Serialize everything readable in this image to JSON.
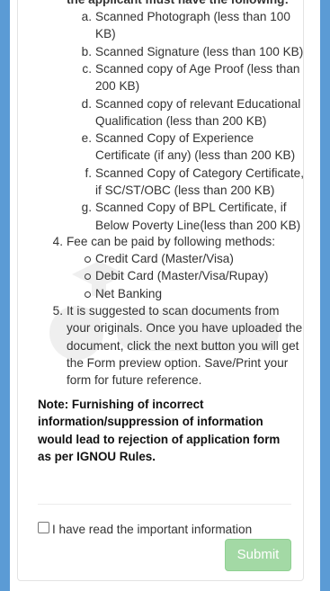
{
  "requirements": {
    "intro_partial": "the applicant must have the following:",
    "items": [
      {
        "marker": "a.",
        "lines": [
          "Scanned Photograph (less than 100",
          "KB)"
        ]
      },
      {
        "marker": "b.",
        "lines": [
          "Scanned Signature (less than 100 KB)"
        ]
      },
      {
        "marker": "c.",
        "lines": [
          "Scanned copy of Age Proof (less than",
          "200 KB)"
        ]
      },
      {
        "marker": "d.",
        "lines": [
          "Scanned copy of relevant Educational",
          "Qualification (less than 200 KB)"
        ]
      },
      {
        "marker": "e.",
        "lines": [
          "Scanned Copy of Experience",
          "Certificate (if any) (less than 200 KB)"
        ]
      },
      {
        "marker": "f.",
        "lines": [
          "Scanned Copy of Category Certificate,",
          "if SC/ST/OBC (less than 200 KB)"
        ]
      },
      {
        "marker": "g.",
        "lines": [
          "Scanned Copy of BPL Certificate, if",
          "Below Poverty Line(less than 200 KB)"
        ]
      }
    ]
  },
  "fee": {
    "marker": "4.",
    "text": "Fee can be paid by following methods:",
    "methods": [
      "Credit Card (Master/Visa)",
      "Debit Card (Master/Visa/Rupay)",
      "Net Banking"
    ]
  },
  "suggestion": {
    "marker": "5.",
    "lines": [
      "It is suggested to scan documents from",
      "your originals. Once you have uploaded the",
      "document, click the next button you will get",
      "the Form preview option. Save/Print your",
      "form for future reference."
    ]
  },
  "note": "Note: Furnishing of incorrect information/suppression of information would lead to rejection of application form as per IGNOU Rules.",
  "confirmation": {
    "label": "I have read the important information",
    "checked": false
  },
  "submit_label": "Submit",
  "colors": {
    "page_background": "#5b9bd5",
    "submit_disabled": "#a3d9a5"
  }
}
